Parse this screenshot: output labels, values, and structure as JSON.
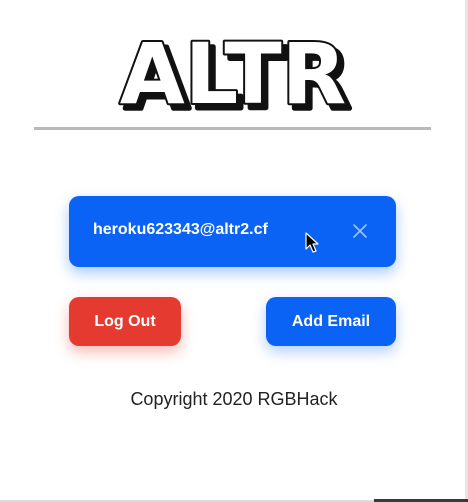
{
  "header": {
    "logo_text": "ALTR"
  },
  "email_card": {
    "email": "heroku623343@altr2.cf",
    "dismiss_icon": "close-icon"
  },
  "actions": {
    "logout_label": "Log Out",
    "add_email_label": "Add Email"
  },
  "footer": {
    "copyright": "Copyright 2020 RGBHack"
  },
  "colors": {
    "primary_blue": "#0a63f5",
    "logout_red": "#e43a2f",
    "divider": "#b9b9b9",
    "text": "#222222"
  }
}
